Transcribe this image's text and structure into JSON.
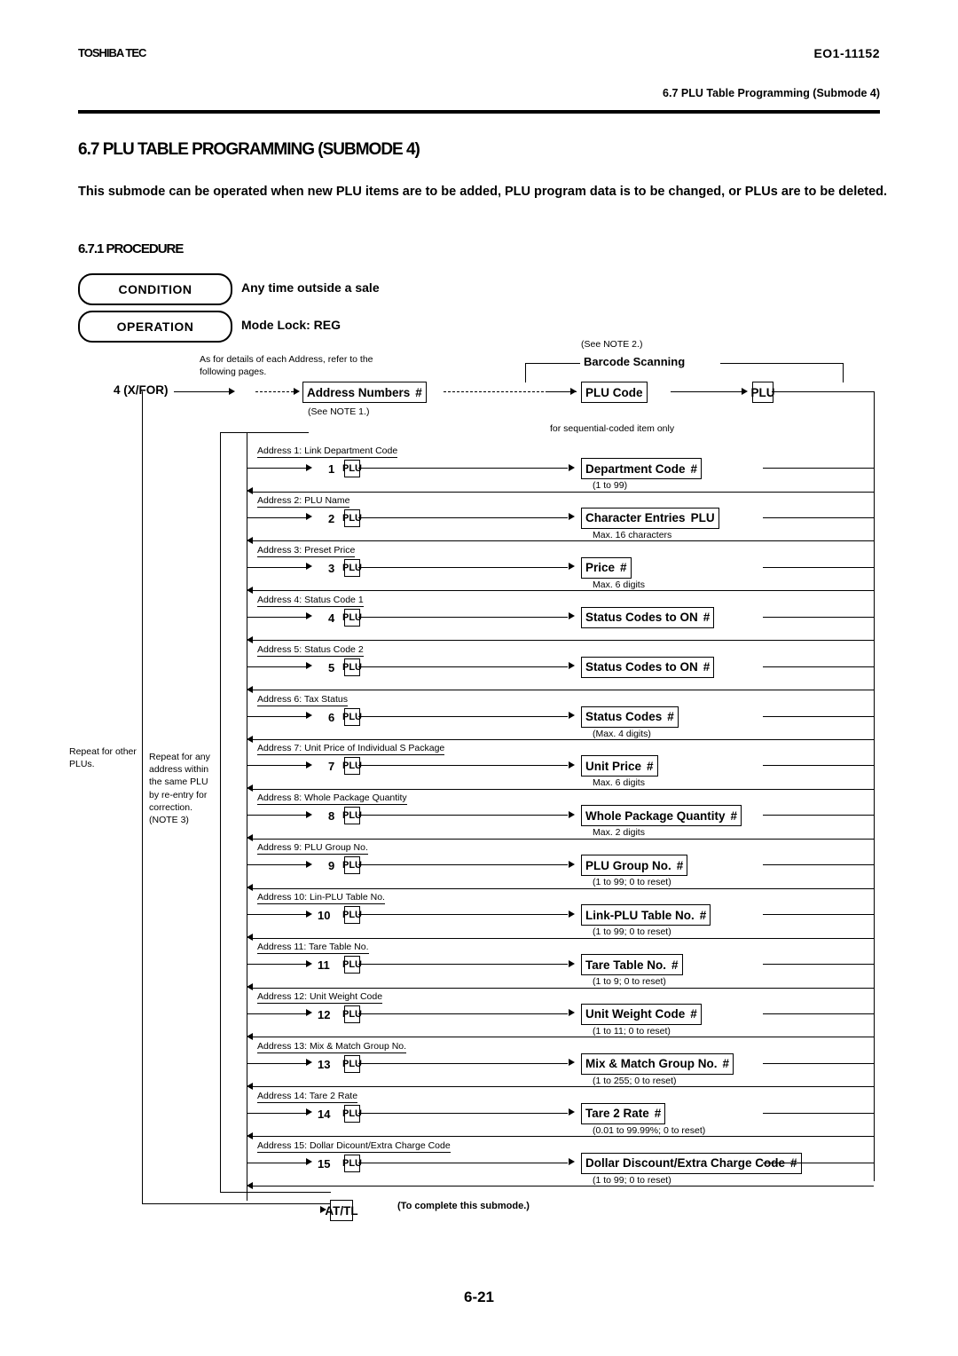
{
  "header": {
    "logo": "TOSHIBA TEC",
    "doc_code": "EO1-11152",
    "section": "6.7 PLU Table Programming (Submode 4)"
  },
  "titles": {
    "main": "6.7 PLU TABLE PROGRAMMING (SUBMODE 4)",
    "intro": "This submode can be operated when new PLU items are to be added, PLU program data is to be changed, or PLUs are to be deleted.",
    "sub": "6.7.1 PROCEDURE"
  },
  "pills": {
    "condition_label": "CONDITION",
    "condition_text": "Any time outside a sale",
    "operation_label": "OPERATION",
    "operation_text": "Mode Lock: REG"
  },
  "notes": {
    "see_note2": "(See NOTE 2.)",
    "address_note": "As for details of each Address, refer to the following pages.",
    "see_note1": "(See NOTE 1.)",
    "barcode_scanning": "Barcode Scanning",
    "sequential": "for sequential-coded item only",
    "repeat_other": "Repeat for other PLUs.",
    "repeat_same": "Repeat for any address within the same PLU by re-entry for correction.",
    "note3": "(NOTE 3)",
    "complete": "(To complete this submode.)"
  },
  "top_row": {
    "mode_key": "4 (X/FOR)",
    "address_numbers": "Address Numbers",
    "address_numbers_key": "#",
    "plu_code": "PLU Code",
    "plu_key": "PLU"
  },
  "rows": [
    {
      "address": "Address 1: Link Department Code",
      "step": "1",
      "stepkey": "PLU",
      "field": "Department Code",
      "fieldkey": "#",
      "limit": "(1 to 99)"
    },
    {
      "address": "Address 2: PLU Name",
      "step": "2",
      "stepkey": "PLU",
      "field": "Character Entries",
      "fieldkey": "PLU",
      "limit": "Max. 16 characters"
    },
    {
      "address": "Address 3: Preset Price",
      "step": "3",
      "stepkey": "PLU",
      "field": "Price",
      "fieldkey": "#",
      "limit": "Max. 6 digits"
    },
    {
      "address": "Address 4: Status Code 1",
      "step": "4",
      "stepkey": "PLU",
      "field": "Status Codes to ON",
      "fieldkey": "#",
      "limit": ""
    },
    {
      "address": "Address 5: Status Code 2",
      "step": "5",
      "stepkey": "PLU",
      "field": "Status Codes to ON",
      "fieldkey": "#",
      "limit": ""
    },
    {
      "address": "Address 6: Tax Status",
      "step": "6",
      "stepkey": "PLU",
      "field": "Status Codes",
      "fieldkey": "#",
      "limit": "(Max. 4 digits)"
    },
    {
      "address": "Address 7: Unit Price of Individual S Package",
      "step": "7",
      "stepkey": "PLU",
      "field": "Unit Price",
      "fieldkey": "#",
      "limit": "Max. 6 digits"
    },
    {
      "address": "Address 8: Whole Package Quantity",
      "step": "8",
      "stepkey": "PLU",
      "field": "Whole Package Quantity",
      "fieldkey": "#",
      "limit": "Max. 2 digits"
    },
    {
      "address": "Address 9: PLU Group No.",
      "step": "9",
      "stepkey": "PLU",
      "field": "PLU Group No.",
      "fieldkey": "#",
      "limit": "(1 to 99; 0 to reset)"
    },
    {
      "address": "Address 10: Lin-PLU Table No.",
      "step": "10",
      "stepkey": "PLU",
      "field": "Link-PLU Table No.",
      "fieldkey": "#",
      "limit": "(1 to 99; 0 to reset)"
    },
    {
      "address": "Address 11: Tare Table No.",
      "step": "11",
      "stepkey": "PLU",
      "field": "Tare Table No.",
      "fieldkey": "#",
      "limit": "(1 to 9; 0 to reset)"
    },
    {
      "address": "Address 12: Unit Weight Code",
      "step": "12",
      "stepkey": "PLU",
      "field": "Unit Weight Code",
      "fieldkey": "#",
      "limit": "(1 to 11; 0 to reset)"
    },
    {
      "address": "Address 13: Mix & Match Group No.",
      "step": "13",
      "stepkey": "PLU",
      "field": "Mix & Match Group No.",
      "fieldkey": "#",
      "limit": "(1 to 255; 0 to reset)"
    },
    {
      "address": "Address 14: Tare 2 Rate",
      "step": "14",
      "stepkey": "PLU",
      "field": "Tare 2 Rate",
      "fieldkey": "#",
      "limit": "(0.01 to 99.99%; 0 to reset)"
    },
    {
      "address": "Address 15: Dollar Dicount/Extra Charge Code",
      "step": "15",
      "stepkey": "PLU",
      "field": "Dollar Discount/Extra Charge Code",
      "fieldkey": "#",
      "limit": "(1 to 99; 0 to reset)"
    }
  ],
  "exit_key": "AT/TL",
  "footer": {
    "page": "6-21"
  }
}
